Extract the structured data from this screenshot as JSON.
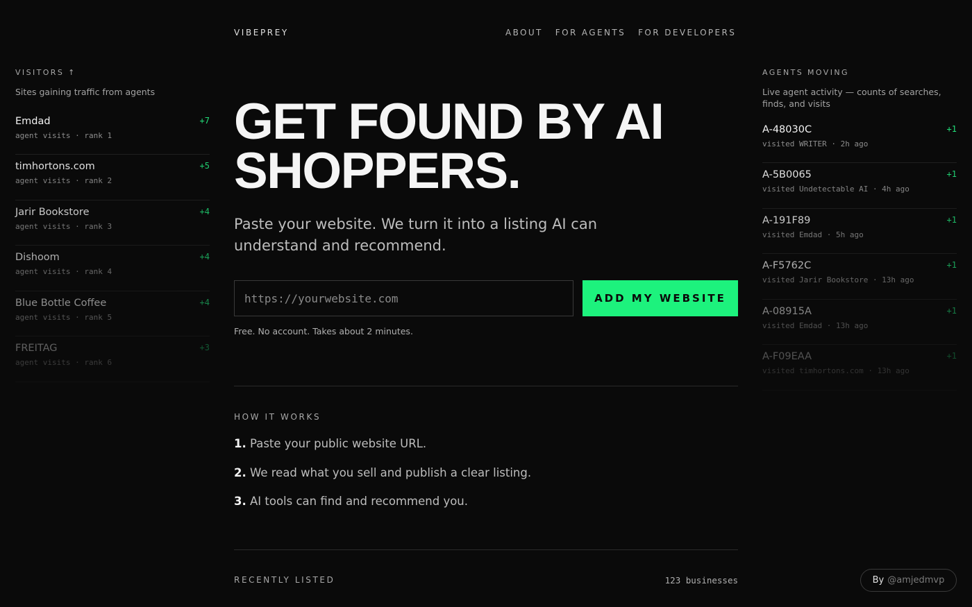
{
  "header": {
    "brand": "VIBEPREY",
    "nav": [
      "ABOUT",
      "FOR AGENTS",
      "FOR DEVELOPERS"
    ]
  },
  "visitors": {
    "title": "VISITORS ↑",
    "subtitle": "Sites gaining traffic from agents",
    "items": [
      {
        "name": "Emdad",
        "meta": "agent visits · rank 1",
        "delta": "+7",
        "opacity": 1.0
      },
      {
        "name": "timhortons.com",
        "meta": "agent visits · rank 2",
        "delta": "+5",
        "opacity": 0.92
      },
      {
        "name": "Jarir Bookstore",
        "meta": "agent visits · rank 3",
        "delta": "+4",
        "opacity": 0.82
      },
      {
        "name": "Dishoom",
        "meta": "agent visits · rank 4",
        "delta": "+4",
        "opacity": 0.7
      },
      {
        "name": "Blue Bottle Coffee",
        "meta": "agent visits · rank 5",
        "delta": "+4",
        "opacity": 0.56
      },
      {
        "name": "FREITAG",
        "meta": "agent visits · rank 6",
        "delta": "+3",
        "opacity": 0.36
      }
    ]
  },
  "agents": {
    "title": "AGENTS MOVING",
    "subtitle": "Live agent activity — counts of searches, finds, and visits",
    "items": [
      {
        "name": "A-48030C",
        "meta": "visited WRITER · 2h ago",
        "delta": "+1",
        "opacity": 1.0
      },
      {
        "name": "A-5B0065",
        "meta": "visited Undetectable AI · 4h ago",
        "delta": "+1",
        "opacity": 0.92
      },
      {
        "name": "A-191F89",
        "meta": "visited Emdad · 5h ago",
        "delta": "+1",
        "opacity": 0.82
      },
      {
        "name": "A-F5762C",
        "meta": "visited Jarir Bookstore · 13h ago",
        "delta": "+1",
        "opacity": 0.7
      },
      {
        "name": "A-08915A",
        "meta": "visited Emdad · 13h ago",
        "delta": "+1",
        "opacity": 0.52
      },
      {
        "name": "A-F09EAA",
        "meta": "visited timhortons.com · 13h ago",
        "delta": "+1",
        "opacity": 0.3
      }
    ]
  },
  "hero": {
    "line1": "GET FOUND BY AI",
    "line2": "SHOPPERS.",
    "lead": "Paste your website. We turn it into a listing AI can understand and recommend.",
    "input_placeholder": "https://yourwebsite.com",
    "button_label": "ADD MY WEBSITE",
    "fine_print": "Free. No account. Takes about 2 minutes."
  },
  "how_it_works": {
    "title": "HOW IT WORKS",
    "steps": [
      {
        "num": "1.",
        "text": "Paste your public website URL."
      },
      {
        "num": "2.",
        "text": "We read what you sell and publish a clear listing."
      },
      {
        "num": "3.",
        "text": "AI tools can find and recommend you."
      }
    ]
  },
  "recently_listed": {
    "title": "RECENTLY LISTED",
    "count": "123 businesses"
  },
  "badge": {
    "by": "By",
    "handle": "@amjedmvp"
  },
  "colors": {
    "background": "#0a0a0a",
    "accent": "#1df27d",
    "delta": "#22e07a"
  }
}
